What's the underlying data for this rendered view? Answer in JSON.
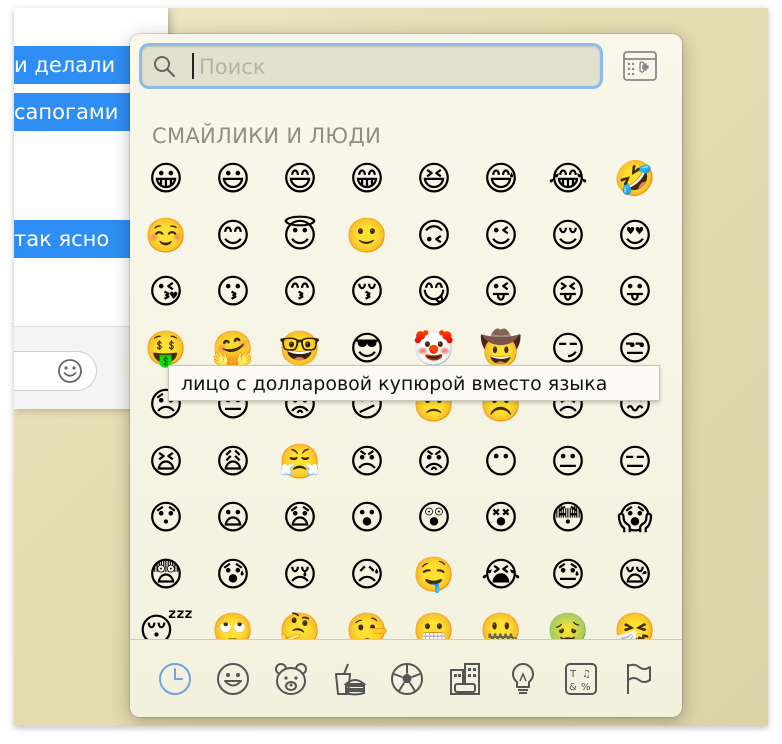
{
  "chat": {
    "bubbles": [
      "и делали",
      "сапогами",
      "так ясно"
    ]
  },
  "picker": {
    "search_placeholder": "Поиск",
    "section_title": "СМАЙЛИКИ И ЛЮДИ",
    "tooltip": "лицо с долларовой купюрой вместо языка",
    "emoji_rows": [
      [
        "😀",
        "😃",
        "😄",
        "😁",
        "😆",
        "😅",
        "😂",
        "🤣"
      ],
      [
        "☺️",
        "😊",
        "😇",
        "🙂",
        "🙃",
        "😉",
        "😌",
        "😍"
      ],
      [
        "😘",
        "😗",
        "😙",
        "😚",
        "😋",
        "😜",
        "😝",
        "😛"
      ],
      [
        "🤑",
        "🤗",
        "🤓",
        "😎",
        "🤡",
        "🤠",
        "😏",
        "😒"
      ],
      [
        "😞",
        "😔",
        "😟",
        "😕",
        "🙁",
        "☹️",
        "😣",
        "😖"
      ],
      [
        "😫",
        "😩",
        "😤",
        "😠",
        "😡",
        "😶",
        "😐",
        "😑"
      ],
      [
        "😯",
        "😦",
        "😧",
        "😮",
        "😲",
        "😵",
        "😳",
        "😱"
      ],
      [
        "😨",
        "😰",
        "😢",
        "😥",
        "🤤",
        "😭",
        "😓",
        "😪"
      ],
      [
        "😴",
        "🙄",
        "🤔",
        "🤥",
        "😬",
        "🤐",
        "🤢",
        "🤧"
      ],
      [
        "😷",
        "🤒",
        "🤕",
        "😈",
        "👿",
        "👹",
        "👺",
        "💩"
      ]
    ],
    "tabs": [
      {
        "name": "tab-recent",
        "icon": "clock-icon"
      },
      {
        "name": "tab-smileys",
        "icon": "smiley-icon"
      },
      {
        "name": "tab-animals",
        "icon": "bear-icon"
      },
      {
        "name": "tab-food",
        "icon": "food-icon"
      },
      {
        "name": "tab-activity",
        "icon": "soccer-ball-icon"
      },
      {
        "name": "tab-travel",
        "icon": "buildings-icon"
      },
      {
        "name": "tab-objects",
        "icon": "lightbulb-icon"
      },
      {
        "name": "tab-symbols",
        "icon": "symbols-icon"
      },
      {
        "name": "tab-flags",
        "icon": "flag-icon"
      }
    ],
    "accent_color": "#8dbbf0"
  }
}
